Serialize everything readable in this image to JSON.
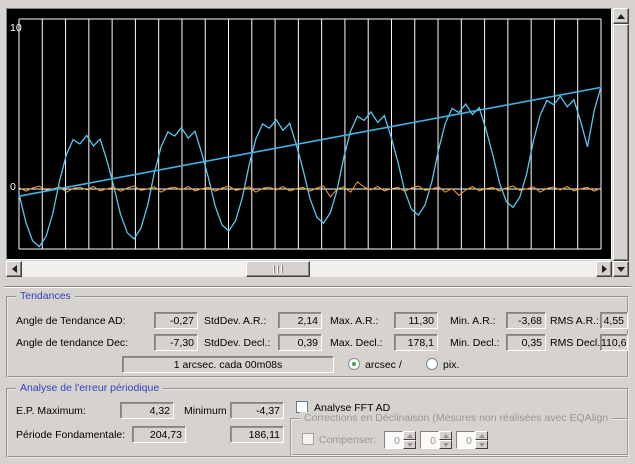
{
  "colors": {
    "background": "#d6d3ce",
    "accent_blue": "#3340c4",
    "chart_background": "#000000",
    "grid": "#ffffff",
    "ra_line": "#55c8f0",
    "trend_line": "#3fb4e8",
    "dec_line": "#f0a028",
    "radio_selected_green": "#3fa53f"
  },
  "chart": {
    "y_axis_labels": [
      "10",
      "0"
    ]
  },
  "chart_data": {
    "type": "line",
    "title": "",
    "xlabel": "",
    "ylabel": "",
    "y_tick_labels": [
      "10",
      "0"
    ],
    "ylim": [
      -4.4,
      10.6
    ],
    "grid": {
      "vertical_lines": 26,
      "color": "#ffffff",
      "zero_line": true
    },
    "legend_position": "none",
    "series": [
      {
        "name": "ra-periodic-error",
        "color": "#55c8f0",
        "values": [
          -0.3,
          -2.07,
          -3.23,
          -3.6,
          -2.96,
          -1.53,
          0.51,
          2.15,
          3.08,
          2.82,
          3.35,
          2.69,
          3.12,
          1.76,
          0.19,
          -1.58,
          -2.74,
          -3.11,
          -2.47,
          -1.04,
          1.0,
          2.64,
          3.57,
          3.31,
          3.84,
          3.18,
          3.61,
          2.25,
          0.68,
          -1.09,
          -2.25,
          -2.62,
          -1.98,
          -0.55,
          1.49,
          3.13,
          4.06,
          3.8,
          4.33,
          3.67,
          4.1,
          2.74,
          1.17,
          -0.6,
          -1.76,
          -2.13,
          -1.49,
          -0.06,
          1.98,
          3.62,
          4.55,
          4.29,
          4.82,
          4.16,
          4.59,
          3.23,
          1.66,
          -0.11,
          -1.27,
          -1.64,
          -1.0,
          0.44,
          2.47,
          4.11,
          5.04,
          4.78,
          5.31,
          4.65,
          5.08,
          3.72,
          2.15,
          0.39,
          -0.78,
          -1.15,
          -0.51,
          0.93,
          2.96,
          4.6,
          5.53,
          5.27,
          5.8,
          5.14,
          5.57,
          4.21,
          2.64,
          4.9,
          6.4
        ]
      },
      {
        "name": "dec-error",
        "color": "#f0a028",
        "values": [
          0.1,
          -0.14,
          0.06,
          0.18,
          -0.08,
          0.0,
          0.14,
          -0.2,
          0.04,
          0.12,
          -0.06,
          0.16,
          -0.12,
          0.02,
          0.1,
          -0.14,
          0.06,
          0.18,
          -0.08,
          0.0,
          0.14,
          -0.2,
          0.04,
          0.12,
          -0.06,
          0.16,
          -0.12,
          0.02,
          0.1,
          -0.14,
          0.06,
          0.18,
          -0.08,
          0.0,
          0.14,
          -0.2,
          0.04,
          0.12,
          -0.06,
          0.16,
          -0.12,
          0.02,
          0.1,
          -0.14,
          0.06,
          0.18,
          -0.5,
          0.0,
          0.14,
          -0.2,
          0.45,
          0.12,
          -0.06,
          0.16,
          -0.12,
          0.02,
          0.1,
          -0.14,
          0.06,
          0.18,
          -0.08,
          0.0,
          0.14,
          -0.2,
          0.04,
          -0.4,
          -0.06,
          0.16,
          -0.12,
          0.02,
          0.1,
          -0.14,
          0.06,
          0.18,
          -0.08,
          0.0,
          0.14,
          -0.2,
          0.04,
          0.12,
          -0.06,
          0.16,
          -0.12,
          0.02,
          0.1,
          -0.14,
          0.06
        ]
      },
      {
        "name": "ra-trend",
        "color": "#3fb4e8",
        "line": {
          "x1": 0,
          "y1": -0.45,
          "x2": 1,
          "y2": 6.35
        }
      }
    ]
  },
  "tendances": {
    "title": "Tendances",
    "angle_ad_label": "Angle de Tendance AD:",
    "angle_ad_value": "-0,27",
    "stddev_ar_label": "StdDev. A.R.:",
    "stddev_ar_value": "2,14",
    "max_ar_label": "Max. A.R.:",
    "max_ar_value": "11,30",
    "min_ar_label": "Min. A.R.:",
    "min_ar_value": "-3,68",
    "rms_ar_label": "RMS A.R.:",
    "rms_ar_value": "4,55",
    "angle_dec_label": "Angle de tendance Dec:",
    "angle_dec_value": "-7,30",
    "stddev_dec_label": "StdDev. Decl.:",
    "stddev_dec_value": "0,39",
    "max_dec_label": "Max. Decl.:",
    "max_dec_value": "178,1",
    "min_dec_label": "Min. Decl.:",
    "min_dec_value": "0,35",
    "rms_dec_label": "RMS Decl.:",
    "rms_dec_value": "110,6",
    "scale_info": "1 arcsec. cada 00m08s",
    "radio_arcsec_label": "arcsec /",
    "radio_pix_label": "pix.",
    "radio_selected": "arcsec"
  },
  "analyse": {
    "title": "Analyse de l'erreur périodique",
    "ep_max_label": "E.P. Maximum:",
    "ep_max_value": "4,32",
    "min_label": "Minimum",
    "min_value": "-4,37",
    "periode_label": "Période Fondamentale:",
    "periode_value1": "204,73",
    "periode_value2": "186,11",
    "fft_checkbox_label": "Analyse FFT AD",
    "fft_checked": false,
    "corrections": {
      "title": "Corrections en Déclinaison (Mesures non réalisées avec EQAlign",
      "compenser_label": "Compenser:",
      "compenser_checked": false,
      "spinners": [
        "0",
        "0",
        "0"
      ]
    }
  }
}
